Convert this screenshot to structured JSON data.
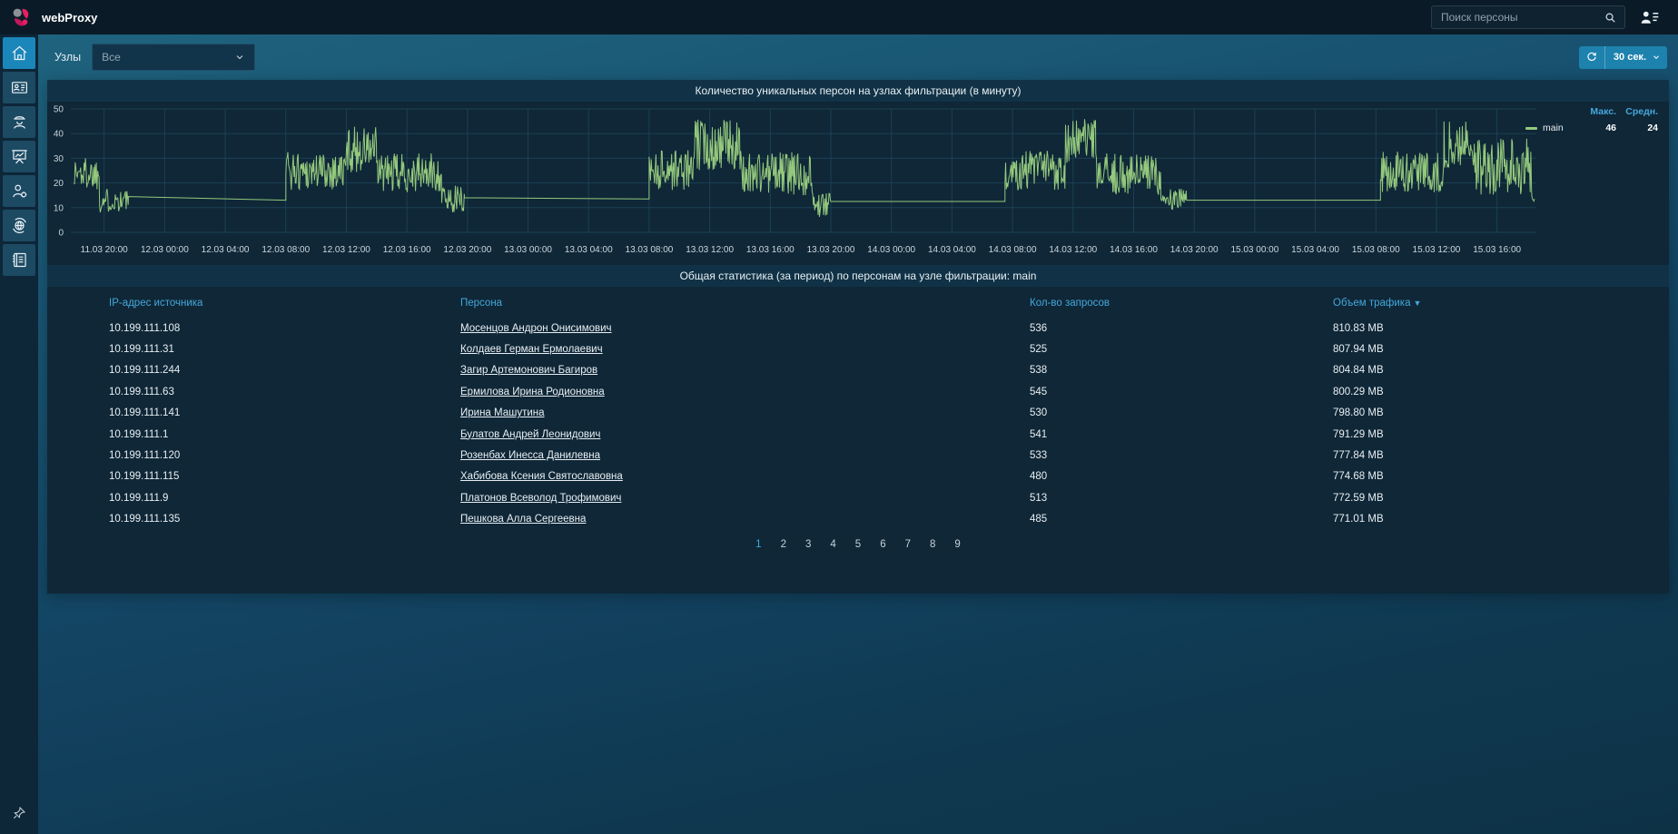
{
  "colors": {
    "accent_blue": "#45a7db",
    "line_green": "#94c97d",
    "button_blue": "#1d82ad",
    "active_tile_blue": "#1b86ba",
    "grid": "#1d4055"
  },
  "topbar": {
    "title": "webProxy",
    "search_placeholder": "Поиск персоны"
  },
  "sidebar": {
    "items": [
      {
        "name": "home",
        "icon": "home",
        "active": true
      },
      {
        "name": "persons",
        "icon": "id-card",
        "active": false
      },
      {
        "name": "agents",
        "icon": "officer",
        "active": false
      },
      {
        "name": "statistics",
        "icon": "chart-board",
        "active": false
      },
      {
        "name": "user-settings",
        "icon": "person-gear",
        "active": false
      },
      {
        "name": "network",
        "icon": "globe-sync",
        "active": false
      },
      {
        "name": "journal",
        "icon": "journal",
        "active": false
      }
    ],
    "pin": {
      "name": "pin",
      "icon": "pin"
    }
  },
  "toolbar": {
    "nodes_label": "Узлы",
    "nodes_value": "Все",
    "refresh_interval": "30 сек."
  },
  "chart_data": {
    "type": "line",
    "title": "Количество уникальных персон на узлах фильтрации (в минуту)",
    "xlabel": "",
    "ylabel": "",
    "ylim": [
      0,
      50
    ],
    "yticks": [
      0,
      10,
      20,
      30,
      40,
      50
    ],
    "grid": true,
    "legend_position": "right",
    "legend": {
      "max_label": "Макс.",
      "avg_label": "Средн.",
      "name": "main",
      "max": 46,
      "avg": 24
    },
    "x_domain_hours": [
      -2.2,
      94.6
    ],
    "tick_interval_hours": 4,
    "x_tick_labels": [
      "11.03 20:00",
      "12.03 00:00",
      "12.03 04:00",
      "12.03 08:00",
      "12.03 12:00",
      "12.03 16:00",
      "12.03 20:00",
      "13.03 00:00",
      "13.03 04:00",
      "13.03 08:00",
      "13.03 12:00",
      "13.03 16:00",
      "13.03 20:00",
      "14.03 00:00",
      "14.03 04:00",
      "14.03 08:00",
      "14.03 12:00",
      "14.03 16:00",
      "14.03 20:00",
      "15.03 00:00",
      "15.03 04:00",
      "15.03 08:00",
      "15.03 12:00",
      "15.03 16:00"
    ],
    "series": [
      {
        "name": "main",
        "color": "#94c97d",
        "segments": [
          {
            "kind": "noise",
            "from": -2.0,
            "to": -0.3,
            "min": 17,
            "max": 31
          },
          {
            "kind": "noise",
            "from": -0.3,
            "to": 1.6,
            "min": 8,
            "max": 18
          },
          {
            "kind": "flat",
            "from": 1.6,
            "to": 12.0,
            "start": 14.5,
            "end": 13.0
          },
          {
            "kind": "noise",
            "from": 12.0,
            "to": 16.0,
            "min": 17,
            "max": 33
          },
          {
            "kind": "noise",
            "from": 16.0,
            "to": 18.0,
            "min": 24,
            "max": 43
          },
          {
            "kind": "noise",
            "from": 18.0,
            "to": 22.3,
            "min": 16,
            "max": 32
          },
          {
            "kind": "noise",
            "from": 22.3,
            "to": 23.8,
            "min": 8,
            "max": 19
          },
          {
            "kind": "flat",
            "from": 23.8,
            "to": 36.0,
            "start": 14.0,
            "end": 13.5
          },
          {
            "kind": "noise",
            "from": 36.0,
            "to": 39.0,
            "min": 17,
            "max": 34
          },
          {
            "kind": "noise",
            "from": 39.0,
            "to": 42.0,
            "min": 25,
            "max": 46
          },
          {
            "kind": "noise",
            "from": 42.0,
            "to": 46.8,
            "min": 15,
            "max": 33
          },
          {
            "kind": "noise",
            "from": 46.8,
            "to": 48.0,
            "min": 6,
            "max": 16
          },
          {
            "kind": "flat",
            "from": 48.0,
            "to": 59.5,
            "start": 12.5,
            "end": 12.5
          },
          {
            "kind": "noise",
            "from": 59.5,
            "to": 63.5,
            "min": 17,
            "max": 34
          },
          {
            "kind": "noise",
            "from": 63.5,
            "to": 65.5,
            "min": 28,
            "max": 46
          },
          {
            "kind": "noise",
            "from": 65.5,
            "to": 69.8,
            "min": 15,
            "max": 32
          },
          {
            "kind": "noise",
            "from": 69.8,
            "to": 71.5,
            "min": 8,
            "max": 18
          },
          {
            "kind": "flat",
            "from": 71.5,
            "to": 84.3,
            "start": 13.0,
            "end": 13.0
          },
          {
            "kind": "noise",
            "from": 84.3,
            "to": 88.5,
            "min": 16,
            "max": 33
          },
          {
            "kind": "noise",
            "from": 88.5,
            "to": 90.5,
            "min": 26,
            "max": 45
          },
          {
            "kind": "noise",
            "from": 90.5,
            "to": 94.3,
            "min": 15,
            "max": 38
          },
          {
            "kind": "noise",
            "from": 94.3,
            "to": 94.5,
            "min": 12,
            "max": 15
          }
        ]
      }
    ]
  },
  "table": {
    "title": "Общая статистика (за период) по персонам на узле фильтрации: main",
    "columns": [
      "IP-адрес источника",
      "Персона",
      "Кол-во запросов",
      "Объем трафика"
    ],
    "sorted_column": "Объем трафика",
    "sort_direction": "desc",
    "rows": [
      [
        "10.199.111.108",
        "Мосенцов Андрон Онисимович",
        "536",
        "810.83 MB"
      ],
      [
        "10.199.111.31",
        "Колдаев Герман Ермолаевич",
        "525",
        "807.94 MB"
      ],
      [
        "10.199.111.244",
        "Загир Артемонович Багиров",
        "538",
        "804.84 MB"
      ],
      [
        "10.199.111.63",
        "Ермилова Ирина Родионовна",
        "545",
        "800.29 MB"
      ],
      [
        "10.199.111.141",
        "Ирина Машутина",
        "530",
        "798.80 MB"
      ],
      [
        "10.199.111.1",
        "Булатов Андрей Леонидович",
        "541",
        "791.29 MB"
      ],
      [
        "10.199.111.120",
        "Розенбах Инесса Данилевна",
        "533",
        "777.84 MB"
      ],
      [
        "10.199.111.115",
        "Хабибова Ксения Святославовна",
        "480",
        "774.68 MB"
      ],
      [
        "10.199.111.9",
        "Платонов Всеволод Трофимович",
        "513",
        "772.59 MB"
      ],
      [
        "10.199.111.135",
        "Пешкова Алла Сергеевна",
        "485",
        "771.01 MB"
      ]
    ]
  },
  "pagination": {
    "pages": [
      "1",
      "2",
      "3",
      "4",
      "5",
      "6",
      "7",
      "8",
      "9"
    ],
    "active": "1"
  }
}
